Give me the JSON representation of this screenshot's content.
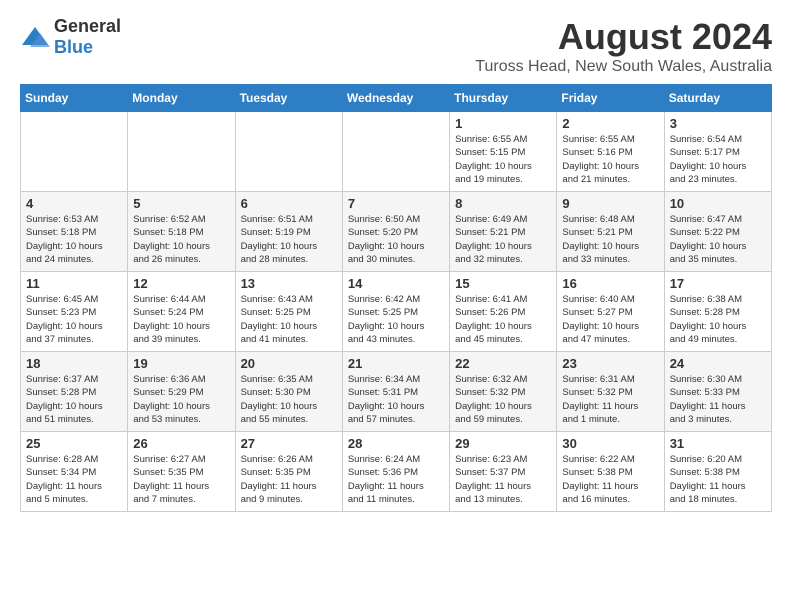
{
  "logo": {
    "general": "General",
    "blue": "Blue"
  },
  "title": "August 2024",
  "subtitle": "Tuross Head, New South Wales, Australia",
  "days_of_week": [
    "Sunday",
    "Monday",
    "Tuesday",
    "Wednesday",
    "Thursday",
    "Friday",
    "Saturday"
  ],
  "weeks": [
    [
      {
        "day": "",
        "info": ""
      },
      {
        "day": "",
        "info": ""
      },
      {
        "day": "",
        "info": ""
      },
      {
        "day": "",
        "info": ""
      },
      {
        "day": "1",
        "info": "Sunrise: 6:55 AM\nSunset: 5:15 PM\nDaylight: 10 hours\nand 19 minutes."
      },
      {
        "day": "2",
        "info": "Sunrise: 6:55 AM\nSunset: 5:16 PM\nDaylight: 10 hours\nand 21 minutes."
      },
      {
        "day": "3",
        "info": "Sunrise: 6:54 AM\nSunset: 5:17 PM\nDaylight: 10 hours\nand 23 minutes."
      }
    ],
    [
      {
        "day": "4",
        "info": "Sunrise: 6:53 AM\nSunset: 5:18 PM\nDaylight: 10 hours\nand 24 minutes."
      },
      {
        "day": "5",
        "info": "Sunrise: 6:52 AM\nSunset: 5:18 PM\nDaylight: 10 hours\nand 26 minutes."
      },
      {
        "day": "6",
        "info": "Sunrise: 6:51 AM\nSunset: 5:19 PM\nDaylight: 10 hours\nand 28 minutes."
      },
      {
        "day": "7",
        "info": "Sunrise: 6:50 AM\nSunset: 5:20 PM\nDaylight: 10 hours\nand 30 minutes."
      },
      {
        "day": "8",
        "info": "Sunrise: 6:49 AM\nSunset: 5:21 PM\nDaylight: 10 hours\nand 32 minutes."
      },
      {
        "day": "9",
        "info": "Sunrise: 6:48 AM\nSunset: 5:21 PM\nDaylight: 10 hours\nand 33 minutes."
      },
      {
        "day": "10",
        "info": "Sunrise: 6:47 AM\nSunset: 5:22 PM\nDaylight: 10 hours\nand 35 minutes."
      }
    ],
    [
      {
        "day": "11",
        "info": "Sunrise: 6:45 AM\nSunset: 5:23 PM\nDaylight: 10 hours\nand 37 minutes."
      },
      {
        "day": "12",
        "info": "Sunrise: 6:44 AM\nSunset: 5:24 PM\nDaylight: 10 hours\nand 39 minutes."
      },
      {
        "day": "13",
        "info": "Sunrise: 6:43 AM\nSunset: 5:25 PM\nDaylight: 10 hours\nand 41 minutes."
      },
      {
        "day": "14",
        "info": "Sunrise: 6:42 AM\nSunset: 5:25 PM\nDaylight: 10 hours\nand 43 minutes."
      },
      {
        "day": "15",
        "info": "Sunrise: 6:41 AM\nSunset: 5:26 PM\nDaylight: 10 hours\nand 45 minutes."
      },
      {
        "day": "16",
        "info": "Sunrise: 6:40 AM\nSunset: 5:27 PM\nDaylight: 10 hours\nand 47 minutes."
      },
      {
        "day": "17",
        "info": "Sunrise: 6:38 AM\nSunset: 5:28 PM\nDaylight: 10 hours\nand 49 minutes."
      }
    ],
    [
      {
        "day": "18",
        "info": "Sunrise: 6:37 AM\nSunset: 5:28 PM\nDaylight: 10 hours\nand 51 minutes."
      },
      {
        "day": "19",
        "info": "Sunrise: 6:36 AM\nSunset: 5:29 PM\nDaylight: 10 hours\nand 53 minutes."
      },
      {
        "day": "20",
        "info": "Sunrise: 6:35 AM\nSunset: 5:30 PM\nDaylight: 10 hours\nand 55 minutes."
      },
      {
        "day": "21",
        "info": "Sunrise: 6:34 AM\nSunset: 5:31 PM\nDaylight: 10 hours\nand 57 minutes."
      },
      {
        "day": "22",
        "info": "Sunrise: 6:32 AM\nSunset: 5:32 PM\nDaylight: 10 hours\nand 59 minutes."
      },
      {
        "day": "23",
        "info": "Sunrise: 6:31 AM\nSunset: 5:32 PM\nDaylight: 11 hours\nand 1 minute."
      },
      {
        "day": "24",
        "info": "Sunrise: 6:30 AM\nSunset: 5:33 PM\nDaylight: 11 hours\nand 3 minutes."
      }
    ],
    [
      {
        "day": "25",
        "info": "Sunrise: 6:28 AM\nSunset: 5:34 PM\nDaylight: 11 hours\nand 5 minutes."
      },
      {
        "day": "26",
        "info": "Sunrise: 6:27 AM\nSunset: 5:35 PM\nDaylight: 11 hours\nand 7 minutes."
      },
      {
        "day": "27",
        "info": "Sunrise: 6:26 AM\nSunset: 5:35 PM\nDaylight: 11 hours\nand 9 minutes."
      },
      {
        "day": "28",
        "info": "Sunrise: 6:24 AM\nSunset: 5:36 PM\nDaylight: 11 hours\nand 11 minutes."
      },
      {
        "day": "29",
        "info": "Sunrise: 6:23 AM\nSunset: 5:37 PM\nDaylight: 11 hours\nand 13 minutes."
      },
      {
        "day": "30",
        "info": "Sunrise: 6:22 AM\nSunset: 5:38 PM\nDaylight: 11 hours\nand 16 minutes."
      },
      {
        "day": "31",
        "info": "Sunrise: 6:20 AM\nSunset: 5:38 PM\nDaylight: 11 hours\nand 18 minutes."
      }
    ]
  ]
}
